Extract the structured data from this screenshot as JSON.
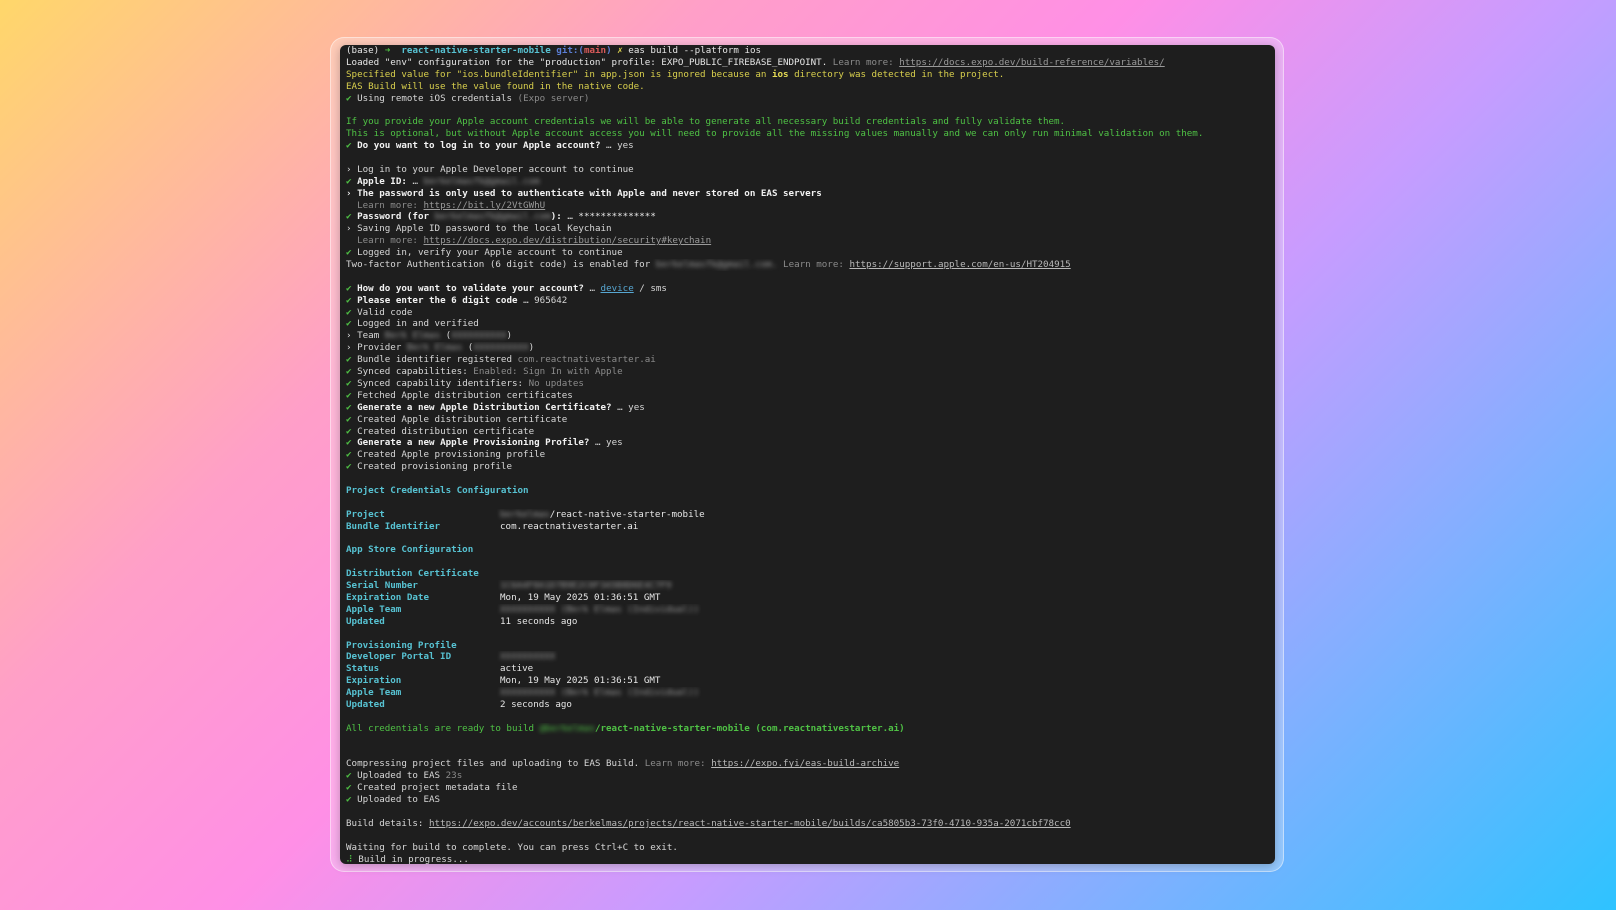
{
  "prompt": {
    "env": "(base)",
    "arrow": "➜",
    "dir": "react-native-starter-mobile",
    "git_prefix": "git:(",
    "branch": "main",
    "git_suffix": ")",
    "x": "✗",
    "command": "eas build --platform ios"
  },
  "log": {
    "l2_main": "Loaded \"env\" configuration for the \"production\" profile: EXPO_PUBLIC_FIREBASE_ENDPOINT.",
    "learn_more": "Learn more:",
    "l2_link": "https://docs.expo.dev/build-reference/variables/",
    "l3": "Specified value for \"ios.bundleIdentifier\" in app.json is ignored because an",
    "l3_ios": "ios",
    "l3_end": "directory was detected in the project.",
    "l4": "EAS Build will use the value found in the native code.",
    "l5_check": "✔",
    "l5": "Using remote iOS credentials",
    "l5_dim": "(Expo server)",
    "l7": "If you provide your Apple account credentials we will be able to generate all necessary build credentials and fully validate them.",
    "l8": "This is optional, but without Apple account access you will need to provide all the missing values manually and we can only run minimal validation on them.",
    "l9_q": "Do you want to log in to your Apple account?",
    "l9_a": "… yes",
    "l11_arrow": "›",
    "l11": "Log in to your Apple Developer account to continue",
    "l12": "Apple ID:",
    "l12_a": "…",
    "l12_blur": "berkelmasfk@gmail.com",
    "l13": "The password is only used to authenticate with Apple and never stored on EAS servers",
    "l14_link": "https://bit.ly/2VtGWhU",
    "l15_a": "Password (for",
    "l15_blur": "berkelmasfk@gmail.com",
    "l15_b": "):",
    "l15_c": "… **************",
    "l16": "Saving Apple ID password to the local Keychain",
    "l17_link": "https://docs.expo.dev/distribution/security#keychain",
    "l18": "Logged in, verify your Apple account to continue",
    "l19": "Two-factor Authentication (6 digit code) is enabled for",
    "l19_blur": "berkelmasfk@gmail.com.",
    "l19_link": "https://support.apple.com/en-us/HT204915",
    "l21_q": "How do you want to validate your account?",
    "l21_a": "…",
    "l21_device": "device",
    "l21_rest": "/ sms",
    "l22_q": "Please enter the 6 digit code",
    "l22_a": "… 965642",
    "l23": "Valid code",
    "l24": "Logged in and verified",
    "l25": "Team",
    "l25_blur": "Berk Elmas",
    "l25_p": "(",
    "l25_blur2": "XXXXXXXXXX",
    "l25_p2": ")",
    "l26": "Provider",
    "l26_blur": "Berk Elmas",
    "l27": "Bundle identifier registered",
    "l27_dim": "com.reactnativestarter.ai",
    "l28": "Synced capabilities:",
    "l28_dim": "Enabled: Sign In with Apple",
    "l29": "Synced capability identifiers:",
    "l29_dim": "No updates",
    "l30": "Fetched Apple distribution certificates",
    "l31_q": "Generate a new Apple Distribution Certificate?",
    "l31_a": "… yes",
    "l32": "Created Apple distribution certificate",
    "l33": "Created distribution certificate",
    "l34_q": "Generate a new Apple Provisioning Profile?",
    "l34_a": "… yes",
    "l35": "Created Apple provisioning profile",
    "l36": "Created provisioning profile"
  },
  "credentials": {
    "heading": "Project Credentials Configuration",
    "project_label": "Project",
    "project_blur": "berkelmas",
    "project_value": "/react-native-starter-mobile",
    "bundle_label": "Bundle Identifier",
    "bundle_value": "com.reactnativestarter.ai",
    "appstore_heading": "App Store Configuration",
    "dist_heading": "Distribution Certificate",
    "serial_label": "Serial Number",
    "serial_blur": "1C6A4F8A1D7B9E2C0F3A5B8D6E4C7F9",
    "exp_label": "Expiration Date",
    "exp_value": "Mon, 19 May 2025 01:36:51 GMT",
    "team_label": "Apple Team",
    "team_blur": "XXXXXXXXXX (Berk Elmas (Individual))",
    "updated_label": "Updated",
    "updated_value": "11 seconds ago",
    "prov_heading": "Provisioning Profile",
    "portal_label": "Developer Portal ID",
    "portal_blur": "XXXXXXXXXX",
    "status_label": "Status",
    "status_value": "active",
    "exp2_label": "Expiration",
    "exp2_value": "Mon, 19 May 2025 01:36:51 GMT",
    "team2_label": "Apple Team",
    "team2_blur": "XXXXXXXXXX (Berk Elmas (Individual))",
    "updated2_label": "Updated",
    "updated2_value": "2 seconds ago",
    "ready_a": "All credentials are ready to build",
    "ready_blur": "@berkelmas",
    "ready_b": "/react-native-starter-mobile (com.reactnativestarter.ai)"
  },
  "upload": {
    "compress": "Compressing project files and uploading to EAS Build.",
    "compress_link": "https://expo.fyi/eas-build-archive",
    "uploaded": "Uploaded to EAS",
    "uploaded_dim": "23s",
    "metadata": "Created project metadata file",
    "uploaded2": "Uploaded to EAS",
    "details_label": "Build details:",
    "details_link": "https://expo.dev/accounts/berkelmas/projects/react-native-starter-mobile/builds/ca5805b3-73f0-4710-935a-2071cbf78cc0",
    "waiting": "Waiting for build to complete. You can press Ctrl+C to exit.",
    "spinner": "⠼",
    "progress": "Build in progress..."
  },
  "colors": {
    "terminal_bg": "#1e1e1e",
    "green": "#4fc145",
    "yellow": "#d8cf4d",
    "cyan": "#57c2d2",
    "dim": "#8b8b8b"
  }
}
